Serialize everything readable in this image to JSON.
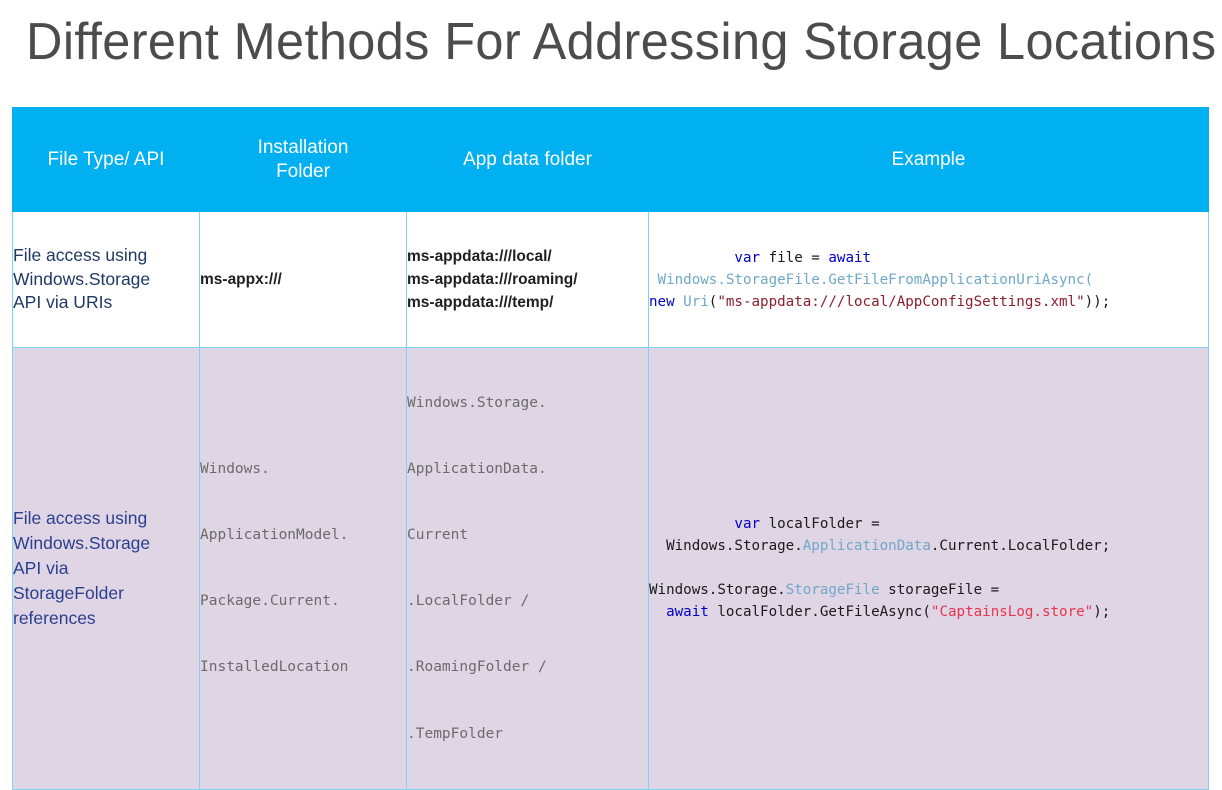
{
  "slide": {
    "title": "Different Methods For Addressing Storage Locations"
  },
  "colors": {
    "header_bg": "#00b0f0",
    "border": "#7fd4f2",
    "row1_bg": "#ffffff",
    "row2_bg": "#e0d5e4",
    "title_text": "#4c4c4c",
    "label_text": "#1f3864",
    "keyword": "#0000c8",
    "type": "#6fa8c8",
    "string": "#8a1f2e",
    "string_alt": "#e8344e"
  },
  "table": {
    "headers": {
      "col1": "File Type/ API",
      "col2_line1": "Installation",
      "col2_line2": "Folder",
      "col3": "App data folder",
      "col4": "Example"
    },
    "rows": [
      {
        "label": "File access using Windows.Storage API via URIs",
        "label_lines": [
          "File access using",
          "Windows.Storage",
          "API via URIs"
        ],
        "installation_folder": "ms-appx:///",
        "app_data_folder_lines": [
          "ms-appdata:///local/",
          "ms-appdata:///roaming/",
          "ms-appdata:///temp/"
        ],
        "example_tokens": [
          {
            "t": "var",
            "c": "kw"
          },
          {
            "t": " file = ",
            "c": "pln"
          },
          {
            "t": "await",
            "c": "kw"
          },
          {
            "t": "\n ",
            "c": "pln"
          },
          {
            "t": "Windows.StorageFile.GetFileFromApplicationUriAsync(",
            "c": "type"
          },
          {
            "t": "\n",
            "c": "pln"
          },
          {
            "t": "new",
            "c": "kw"
          },
          {
            "t": " ",
            "c": "pln"
          },
          {
            "t": "Uri",
            "c": "type"
          },
          {
            "t": "(",
            "c": "pln"
          },
          {
            "t": "\"ms-appdata:///local/AppConfigSettings.xml\"",
            "c": "str"
          },
          {
            "t": "));",
            "c": "pln"
          }
        ]
      },
      {
        "label": "File access using Windows.Storage API via StorageFolder references",
        "label_lines": [
          "File access using",
          "Windows.Storage",
          "API via",
          "StorageFolder",
          "references"
        ],
        "installation_folder_lines": [
          "Windows.",
          "ApplicationModel.",
          "Package.Current.",
          "InstalledLocation"
        ],
        "app_data_folder_lines": [
          "Windows.Storage.",
          "ApplicationData.",
          "Current",
          ".LocalFolder /",
          ".RoamingFolder /",
          ".TempFolder"
        ],
        "example_tokens": [
          {
            "t": "var",
            "c": "kw"
          },
          {
            "t": " localFolder =\n  Windows.Storage.",
            "c": "pln"
          },
          {
            "t": "ApplicationData",
            "c": "type"
          },
          {
            "t": ".Current.LocalFolder;\n\nWindows.Storage.",
            "c": "pln"
          },
          {
            "t": "StorageFile",
            "c": "type"
          },
          {
            "t": " storageFile =\n  ",
            "c": "pln"
          },
          {
            "t": "await",
            "c": "kw"
          },
          {
            "t": " localFolder.GetFileAsync(",
            "c": "pln"
          },
          {
            "t": "\"CaptainsLog.store\"",
            "c": "str2"
          },
          {
            "t": ");",
            "c": "pln"
          }
        ]
      }
    ]
  }
}
